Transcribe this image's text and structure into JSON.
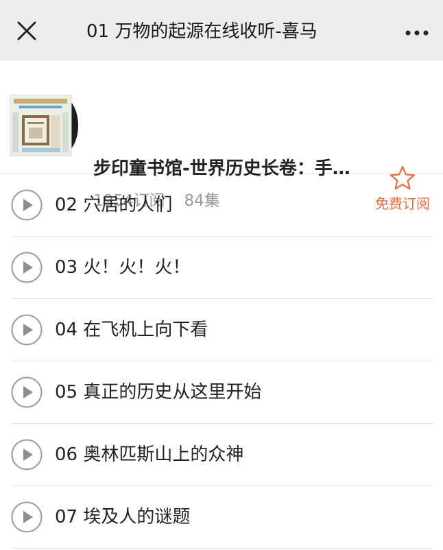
{
  "topbar": {
    "title": "01 万物的起源在线收听-喜马",
    "close_icon": "close-icon",
    "more_icon": "more-icon"
  },
  "album": {
    "name": "步印童书馆-世界历史长卷：手…",
    "subscribers": "1954订阅",
    "episodes": "84集",
    "subscribe_label": "免费订阅",
    "accent_color": "#f06a3a"
  },
  "tracks": [
    {
      "title": "02 穴居的人们"
    },
    {
      "title": "03 火！火！火！"
    },
    {
      "title": "04 在飞机上向下看"
    },
    {
      "title": "05 真正的历史从这里开始"
    },
    {
      "title": "06 奥林匹斯山上的众神"
    },
    {
      "title": "07 埃及人的谜题"
    }
  ]
}
